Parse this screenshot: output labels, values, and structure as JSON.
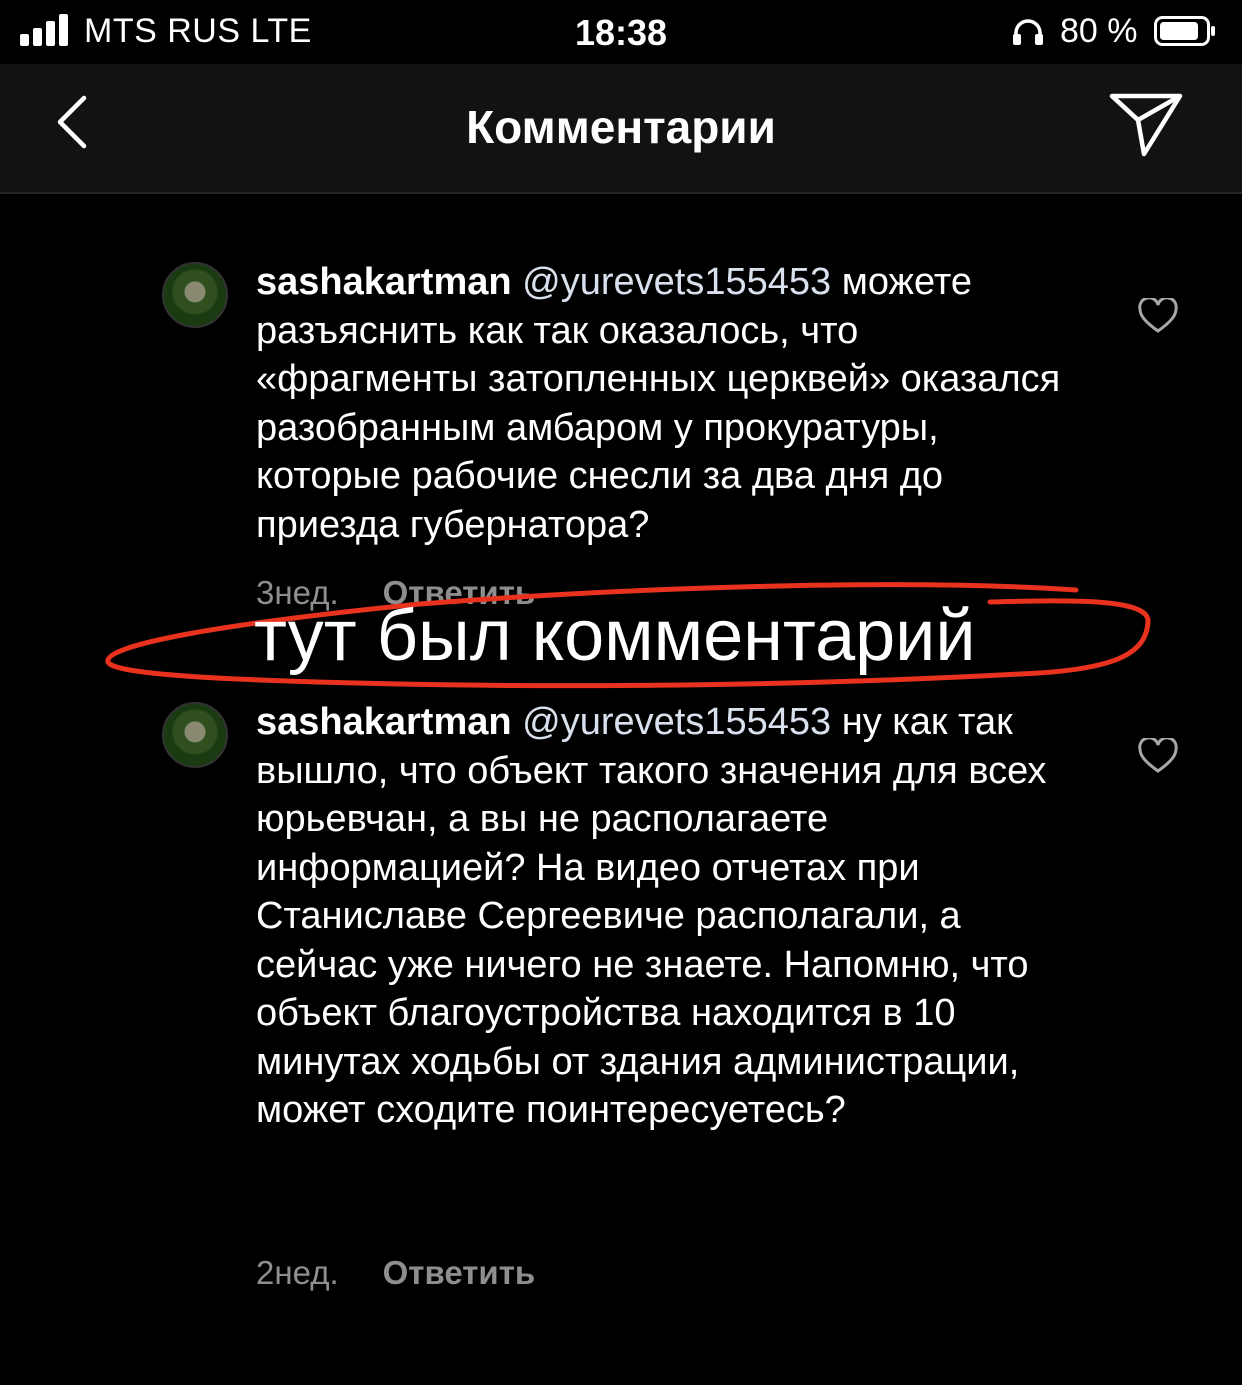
{
  "status_bar": {
    "carrier": "MTS RUS  LTE",
    "time": "18:38",
    "battery": "80 %"
  },
  "header": {
    "title": "Комментарии",
    "back_icon": "chevron-left-icon",
    "send_icon": "paper-plane-icon"
  },
  "comments": [
    {
      "username": "sashakartman",
      "mention": "@yurevets155453",
      "text": "можете разъяснить как так оказалось, что «фрагменты затопленных церквей» оказался разобранным амбаром у прокуратуры, которые рабочие снесли за два дня до приезда губернатора?",
      "time": "3нед.",
      "reply_label": "Ответить"
    },
    {
      "username": "sashakartman",
      "mention": "@yurevets155453",
      "text": "ну как так вышло, что объект такого значения для всех юрьевчан, а вы не располагаете информацией? На видео отчетах при Станиславе Сергеевиче располагали, а сейчас уже ничего не знаете. Напомню, что объект благоустройства находится в 10 минутах ходьбы от здания администрации, может сходите поинтересуетесь?",
      "time": "2нед.",
      "reply_label": "Ответить"
    }
  ],
  "annotation": {
    "text": "тут был комментарий",
    "color": "#e8321e"
  },
  "colors": {
    "background": "#000000",
    "nav_background": "#121212",
    "meta_text": "#8e8e8e"
  }
}
